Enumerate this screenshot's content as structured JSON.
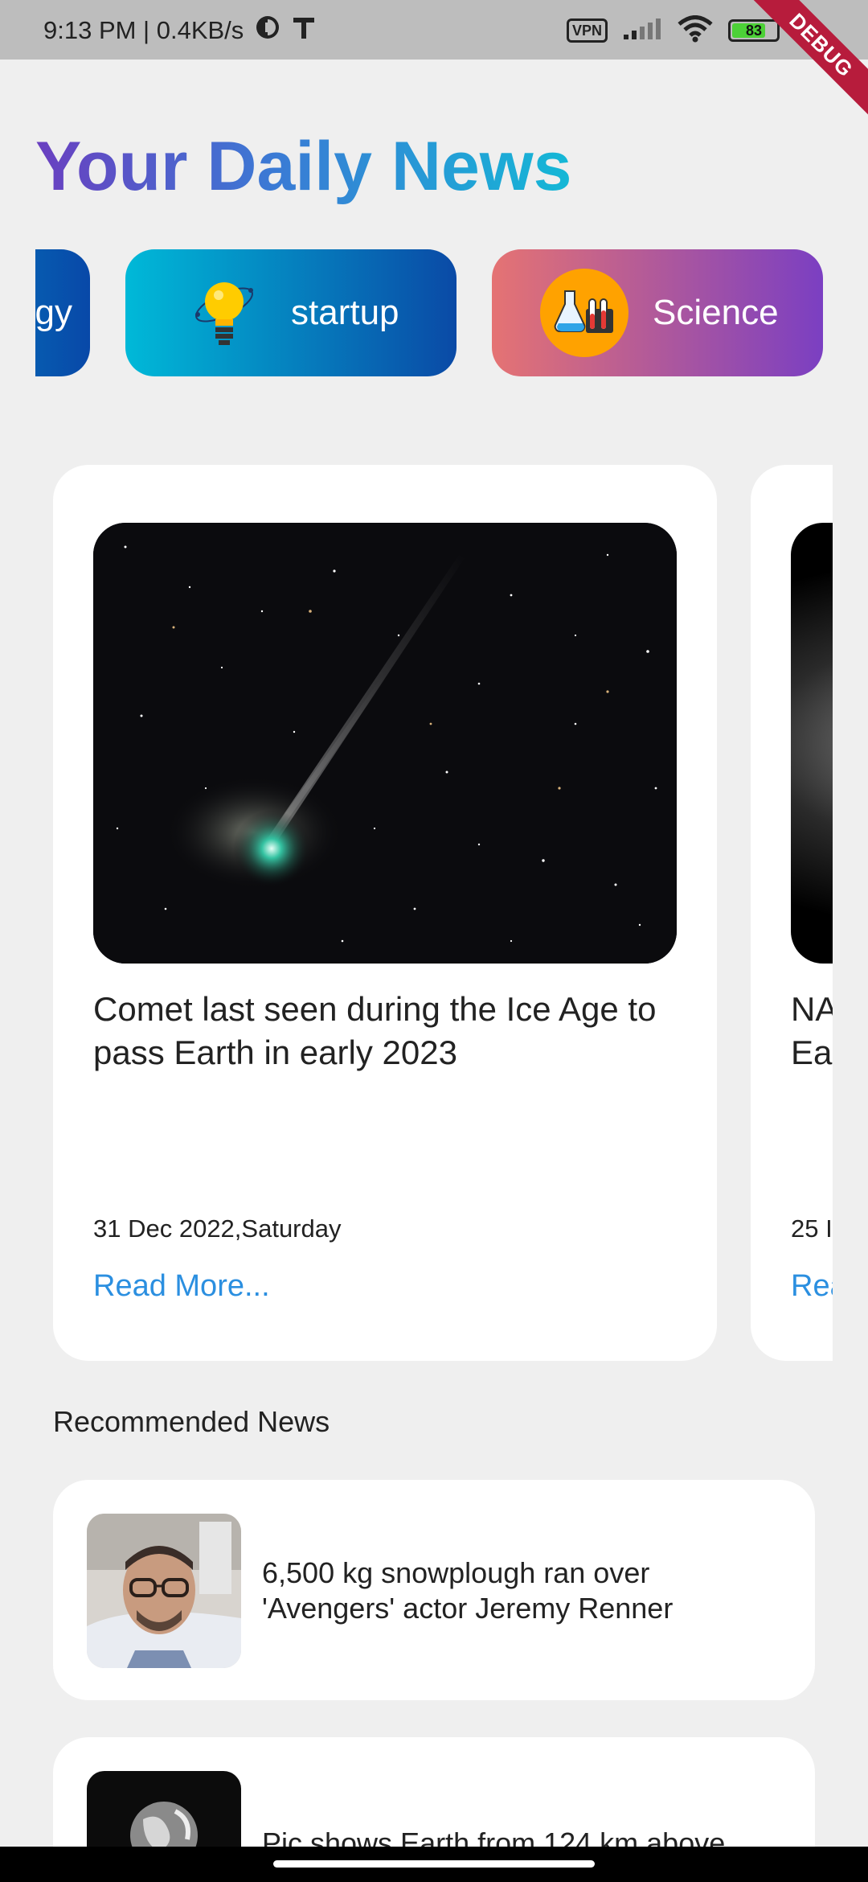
{
  "status_bar": {
    "time_speed": "9:13 PM | 0.4KB/s",
    "vpn": "VPN",
    "battery": "83"
  },
  "debug_banner": "DEBUG",
  "header": {
    "title": "Your Daily News"
  },
  "categories": [
    {
      "label": "gy"
    },
    {
      "label": "startup"
    },
    {
      "label": "Science"
    }
  ],
  "featured": [
    {
      "title": "Comet last seen during the Ice Age to pass Earth in early 2023",
      "date": "31 Dec 2022,Saturday",
      "link": "Read More..."
    },
    {
      "title_line1": "NA",
      "title_line2": "Ea",
      "date": "25 I",
      "link": "Rea"
    }
  ],
  "recommended": {
    "section_title": "Recommended News",
    "items": [
      {
        "title": "6,500 kg snowplough ran over 'Avengers' actor Jeremy Renner"
      },
      {
        "title": "Pic shows Earth from 124 km above"
      }
    ]
  },
  "colors": {
    "accent_link": "#2b8fe0",
    "title_gradient_start": "#6a3fc0",
    "title_gradient_end": "#14b8d6"
  }
}
